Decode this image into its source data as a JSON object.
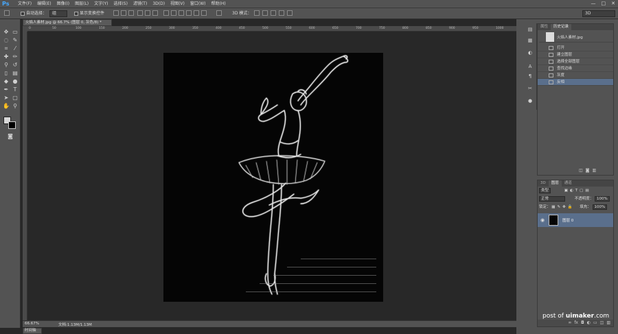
{
  "app": {
    "logo": "Ps",
    "menu": [
      "文件(F)",
      "编辑(E)",
      "图像(I)",
      "图层(L)",
      "文字(Y)",
      "选择(S)",
      "滤镜(T)",
      "3D(D)",
      "视图(V)",
      "窗口(W)",
      "帮助(H)"
    ],
    "window_controls": [
      "—",
      "□",
      "✕"
    ]
  },
  "options_bar": {
    "auto_select_label": "自动选择：",
    "auto_select_value": "组",
    "show_transform_label": "显示变换控件",
    "mode_3d_label": "3D 模式：",
    "workspace_value": "3D"
  },
  "document": {
    "tab_title": "火焰人素材.jpg @ 66.7% (图层 0, 灰色/8) *",
    "zoom": "66.67%",
    "doc_info": "文档:1.13M/1.13M",
    "ruler_marks": [
      "0",
      "50",
      "100",
      "150",
      "200",
      "250",
      "300",
      "350",
      "400",
      "450",
      "500",
      "550",
      "600",
      "650",
      "700",
      "750",
      "800",
      "850",
      "900",
      "950",
      "1000"
    ]
  },
  "timeline_tab": "时间轴",
  "history_panel": {
    "tabs": [
      "属性",
      "历史记录"
    ],
    "snapshot_name": "火焰人素材.jpg",
    "items": [
      {
        "label": "打开",
        "selected": false
      },
      {
        "label": "建立图层",
        "selected": false
      },
      {
        "label": "选择全部图层",
        "selected": false
      },
      {
        "label": "查找边缘",
        "selected": false
      },
      {
        "label": "灰度",
        "selected": false
      },
      {
        "label": "反相",
        "selected": true
      }
    ]
  },
  "layers_panel": {
    "tabs": [
      "3D",
      "图层",
      "通道"
    ],
    "filter_kind": "类型",
    "blend_mode": "正常",
    "opacity_label": "不透明度：",
    "opacity_value": "100%",
    "lock_label": "锁定：",
    "fill_label": "填充：",
    "fill_value": "100%",
    "layer_name": "图层 0"
  },
  "watermark": {
    "prefix": "post of ",
    "brand": "uimaker",
    "suffix": ".com"
  },
  "colors": {
    "panel_bg": "#535353",
    "work_bg": "#282828",
    "selection": "#5a6f8c",
    "ps_blue": "#46a8ff"
  }
}
